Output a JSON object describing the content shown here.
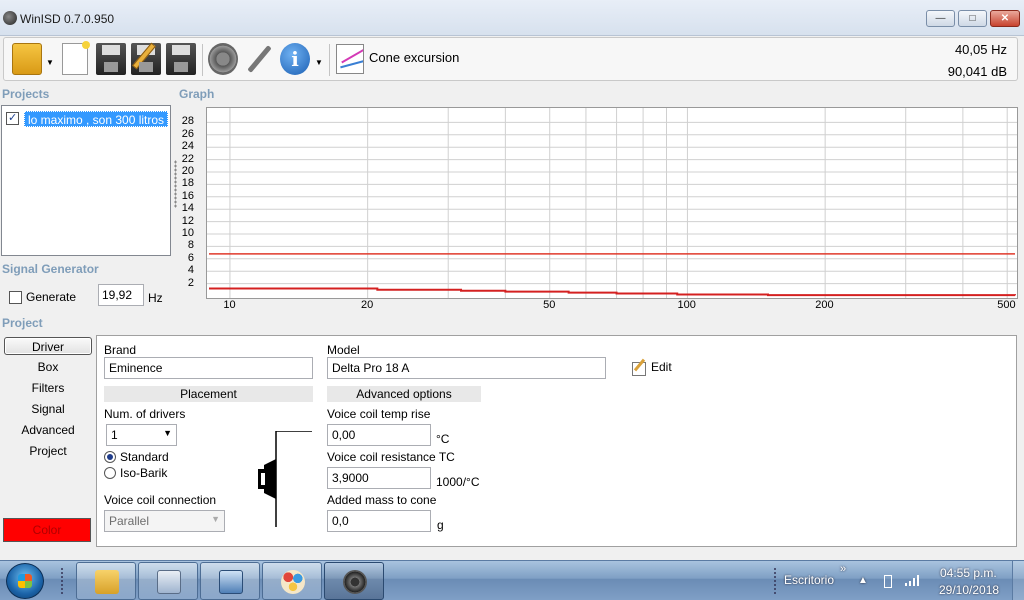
{
  "window": {
    "title": "WinISD 0.7.0.950",
    "min_label": "—",
    "max_label": "□",
    "close_label": "✕"
  },
  "toolbar": {
    "graph_label": "Cone excursion",
    "frequency": "40,05 Hz",
    "level": "90,041 dB"
  },
  "sections": {
    "projects": "Projects",
    "graph": "Graph",
    "signal_generator": "Signal Generator",
    "project": "Project"
  },
  "projects": [
    {
      "name": "lo maximo , son  300 litros",
      "checked": true
    }
  ],
  "signal_generator": {
    "generate_label": "Generate",
    "frequency": "19,92",
    "unit": "Hz",
    "checked": false
  },
  "chart_data": {
    "type": "line",
    "title": "",
    "xlabel": "",
    "ylabel": "",
    "x_scale": "log",
    "xlim": [
      9,
      520
    ],
    "ylim": [
      0,
      30
    ],
    "x_ticks": [
      "10",
      "20",
      "50",
      "100",
      "200",
      "500"
    ],
    "y_ticks": [
      "2",
      "4",
      "6",
      "8",
      "10",
      "12",
      "14",
      "16",
      "18",
      "20",
      "22",
      "24",
      "26",
      "28"
    ],
    "grid": true,
    "series": [
      {
        "color": "#e0392b",
        "x": [
          9,
          520
        ],
        "y": [
          6.8,
          6.8
        ]
      },
      {
        "color": "#d42020",
        "step": true,
        "x": [
          9,
          21,
          32,
          40,
          55,
          70,
          95,
          150,
          520
        ],
        "y": [
          1.2,
          1.0,
          0.85,
          0.7,
          0.55,
          0.4,
          0.25,
          0.15,
          0.1
        ]
      }
    ]
  },
  "nav": {
    "items": [
      "Driver",
      "Box",
      "Filters",
      "Signal",
      "Advanced",
      "Project"
    ],
    "active": "Driver",
    "color_label": "Color",
    "color_value": "#ff0000"
  },
  "driver": {
    "brand_label": "Brand",
    "brand": "Eminence",
    "model_label": "Model",
    "model": "Delta Pro 18 A",
    "edit_label": "Edit",
    "placement_header": "Placement",
    "num_drivers_label": "Num. of drivers",
    "num_drivers": "1",
    "radio_standard": "Standard",
    "radio_isobarik": "Iso-Barik",
    "coil_connection_label": "Voice coil connection",
    "coil_connection": "Parallel",
    "advanced_header": "Advanced options",
    "temp_rise_label": "Voice coil temp rise",
    "temp_rise": "0,00",
    "temp_rise_unit": "°C",
    "resistance_tc_label": "Voice coil resistance TC",
    "resistance_tc": "3,9000",
    "resistance_tc_unit": "1000/°C",
    "added_mass_label": "Added mass to cone",
    "added_mass": "0,0",
    "added_mass_unit": "g"
  },
  "taskbar": {
    "desktop_label": "Escritorio",
    "expand_label": "»",
    "time": "04:55 p.m.",
    "date": "29/10/2018"
  }
}
